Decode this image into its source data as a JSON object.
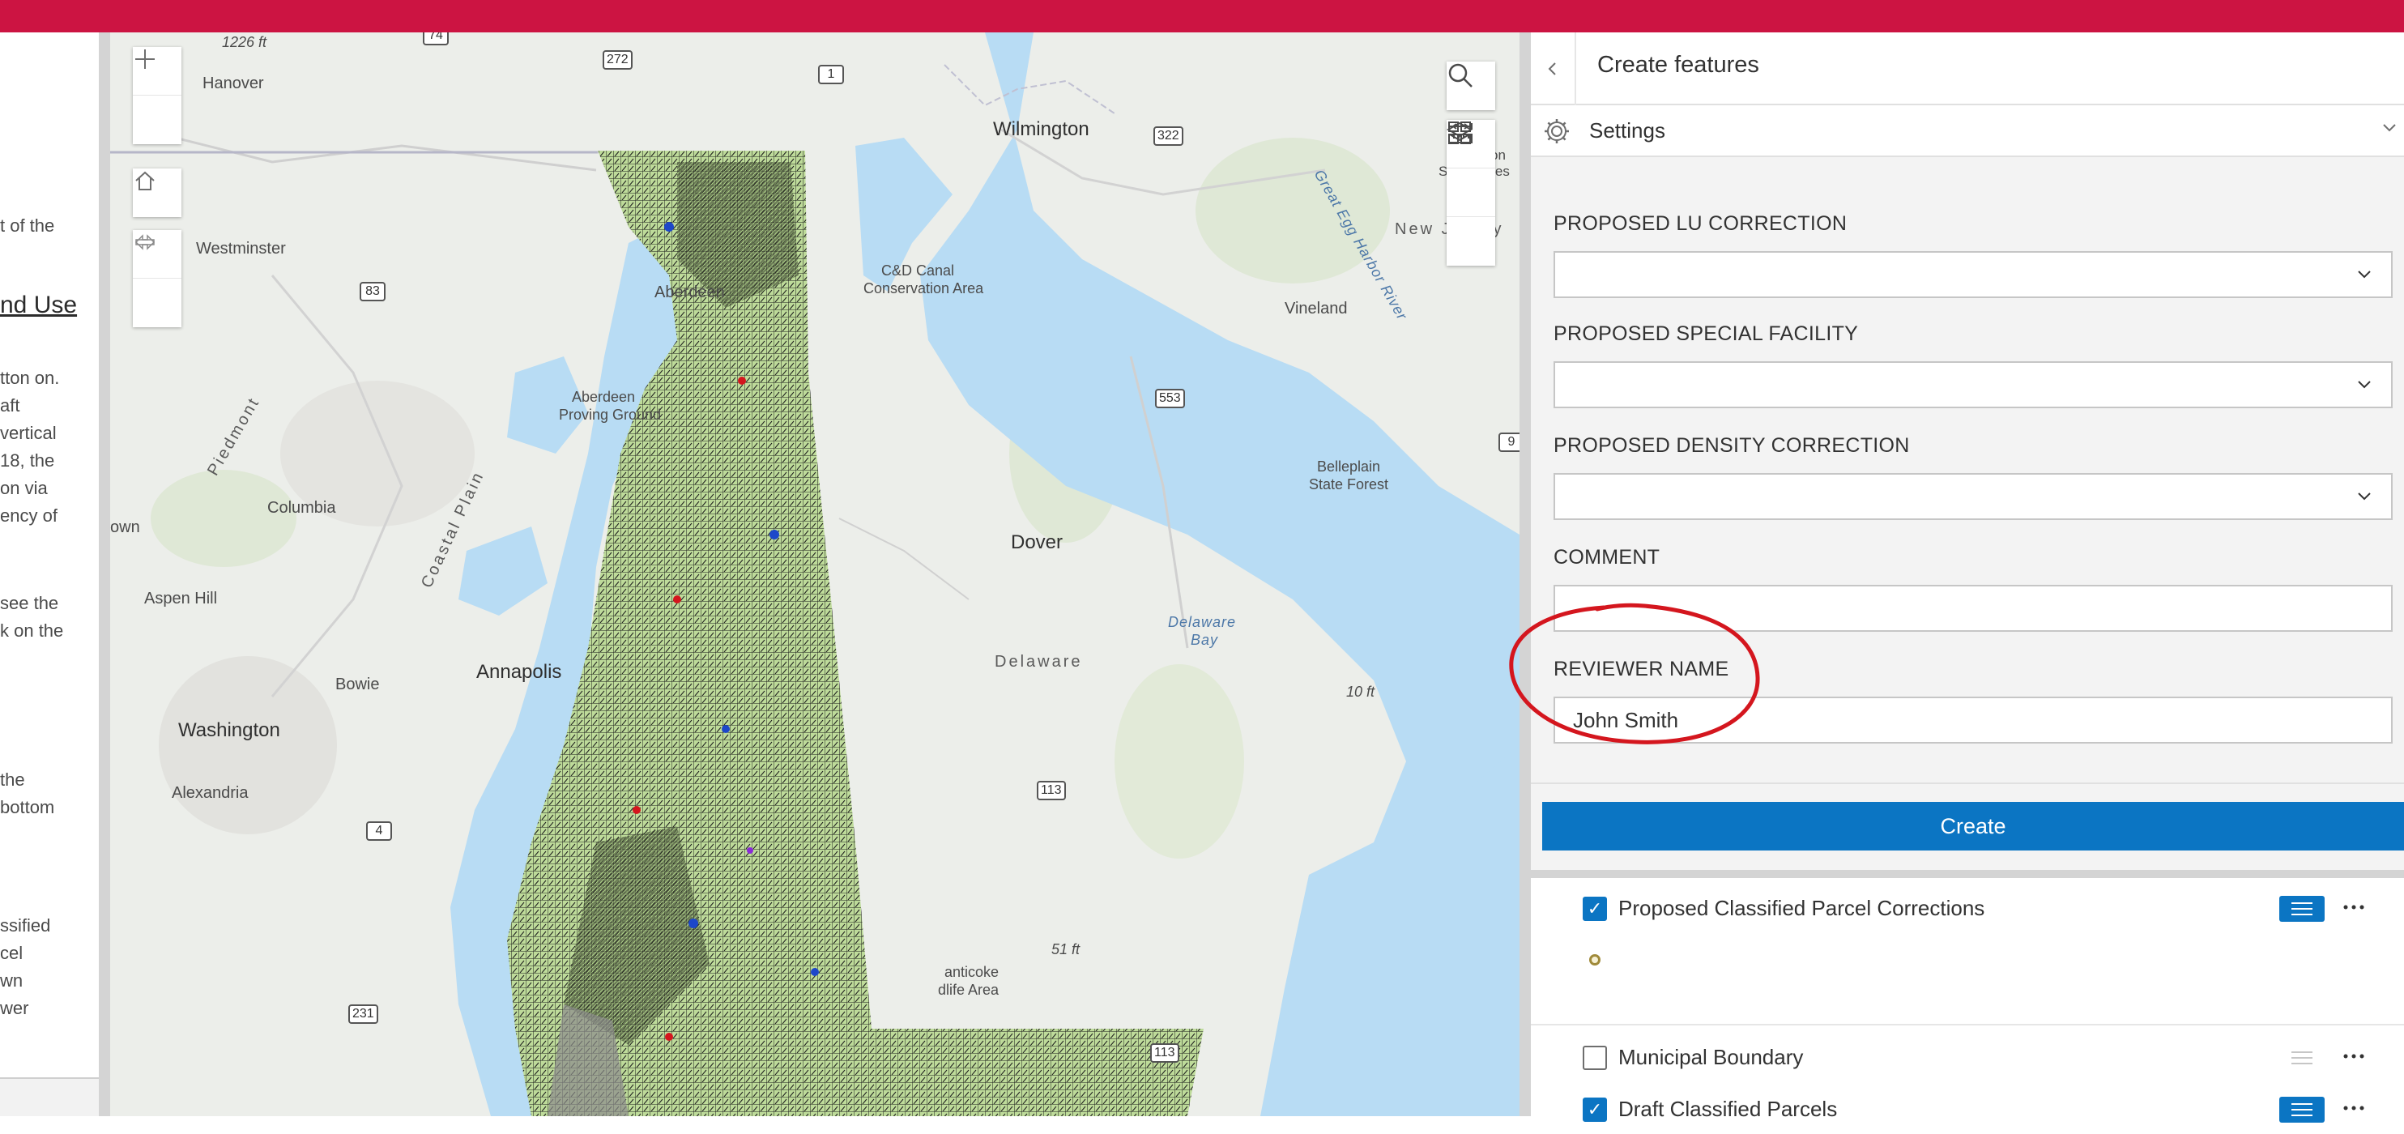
{
  "left_panel": {
    "lines": [
      {
        "text": "t of the",
        "top": 0
      },
      {
        "text": "nd Use",
        "top": 0,
        "heading": true
      },
      {
        "text": "tton on.",
        "top": 0
      },
      {
        "text": "aft",
        "top": 0
      },
      {
        "text": "vertical",
        "top": 0
      },
      {
        "text": "18, the",
        "top": 0
      },
      {
        "text": "on via",
        "top": 0
      },
      {
        "text": "ency of",
        "top": 0
      },
      {
        "text": "see the",
        "top": 0
      },
      {
        "text": "k on the",
        "top": 0
      },
      {
        "text": "the",
        "top": 0
      },
      {
        "text": "bottom",
        "top": 0
      },
      {
        "text": "ssified",
        "top": 0
      },
      {
        "text": "cel",
        "top": 0
      },
      {
        "text": "wn",
        "top": 0
      },
      {
        "text": "wer",
        "top": 0
      }
    ]
  },
  "map": {
    "labels": {
      "hanover": "Hanover",
      "elev1": "1226 ft",
      "wilmington": "Wilmington",
      "westminster": "Westminster",
      "aberdeen": "Aberdeen",
      "cd_canal": "C&D Canal",
      "conservation": "Conservation Area",
      "vineland": "Vineland",
      "apg1": "Aberdeen",
      "apg2": "Proving Ground",
      "piedmont": "Piedmont",
      "coastal": "Coastal Plain",
      "columbia": "Columbia",
      "belleplain1": "Belleplain",
      "belleplain2": "State Forest",
      "town": "own",
      "dover": "Dover",
      "aspen": "Aspen Hill",
      "delaware_bay1": "Delaware",
      "delaware_bay2": "Bay",
      "bowie": "Bowie",
      "annapolis": "Annapolis",
      "delaware": "Delaware",
      "elev2": "10 ft",
      "washington": "Washington",
      "alexandria": "Alexandria",
      "elev3": "51 ft",
      "nanticoke1": "anticoke",
      "nanticoke2": "dlife Area",
      "new_jersey": "New Jersey",
      "great_egg": "Great Egg Harbor River",
      "state_forest": "State Fores",
      "on": "on"
    },
    "shields": {
      "s74": "74",
      "s272": "272",
      "s1": "1",
      "s322": "322",
      "s83": "83",
      "s553": "553",
      "s9": "9",
      "s113a": "113",
      "s4": "4",
      "s231": "231",
      "s113b": "113"
    },
    "colors": {
      "water": "#b8dcf4",
      "land": "#eceeea",
      "parcels": "#bedb9a",
      "parcel_outline": "#1a1a1a"
    }
  },
  "right_panel": {
    "title": "Create features",
    "settings_label": "Settings",
    "fields": [
      {
        "label": "PROPOSED LU CORRECTION",
        "value": "",
        "type": "dropdown"
      },
      {
        "label": "PROPOSED SPECIAL FACILITY",
        "value": "",
        "type": "dropdown"
      },
      {
        "label": "PROPOSED DENSITY CORRECTION",
        "value": "",
        "type": "dropdown"
      },
      {
        "label": "COMMENT",
        "value": "",
        "type": "text"
      },
      {
        "label": "REVIEWER NAME",
        "value": "John Smith",
        "type": "text"
      }
    ],
    "create_label": "Create",
    "layers": [
      {
        "name": "Proposed Classified Parcel Corrections",
        "checked": true
      },
      {
        "name": "Municipal Boundary",
        "checked": false
      },
      {
        "name": "Draft Classified Parcels",
        "checked": true
      }
    ]
  },
  "colors": {
    "topbar": "#cc1442",
    "accent": "#0b75c3",
    "annotation": "#d4161e"
  }
}
